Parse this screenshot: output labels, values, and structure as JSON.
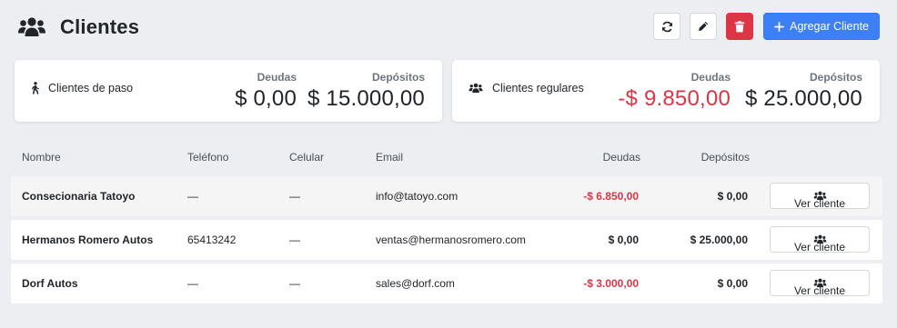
{
  "header": {
    "title": "Clientes",
    "title_icon": "users-icon",
    "actions": {
      "refresh_icon": "refresh-icon",
      "edit_icon": "pencil-icon",
      "delete_icon": "trash-icon",
      "add_label": "Agregar Cliente",
      "add_icon": "plus-icon"
    }
  },
  "summary": {
    "walkin": {
      "label": "Clientes de paso",
      "icon": "walking-person-icon",
      "debts_label": "Deudas",
      "debts_value": "$ 0,00",
      "deposits_label": "Depósitos",
      "deposits_value": "$ 15.000,00"
    },
    "regular": {
      "label": "Clientes regulares",
      "icon": "users-icon",
      "debts_label": "Deudas",
      "debts_value": "-$ 9.850,00",
      "deposits_label": "Depósitos",
      "deposits_value": "$ 25.000,00"
    }
  },
  "table": {
    "columns": [
      "Nombre",
      "Teléfono",
      "Celular",
      "Email",
      "Deudas",
      "Depósitos"
    ],
    "view_button_label": "Ver cliente",
    "rows": [
      {
        "name": "Consecionaria Tatoyo",
        "phone": "—",
        "cell": "—",
        "email": "info@tatoyo.com",
        "debt": "-$ 6.850,00",
        "deposit": "$ 0,00"
      },
      {
        "name": "Hermanos Romero Autos",
        "phone": "65413242",
        "cell": "—",
        "email": "ventas@hermanosromero.com",
        "debt": "$ 0,00",
        "deposit": "$ 25.000,00"
      },
      {
        "name": "Dorf Autos",
        "phone": "—",
        "cell": "—",
        "email": "sales@dorf.com",
        "debt": "-$ 3.000,00",
        "deposit": "$ 0,00"
      }
    ]
  },
  "colors": {
    "primary": "#3d7ff6",
    "danger": "#dc3545",
    "background": "#eceef1"
  }
}
